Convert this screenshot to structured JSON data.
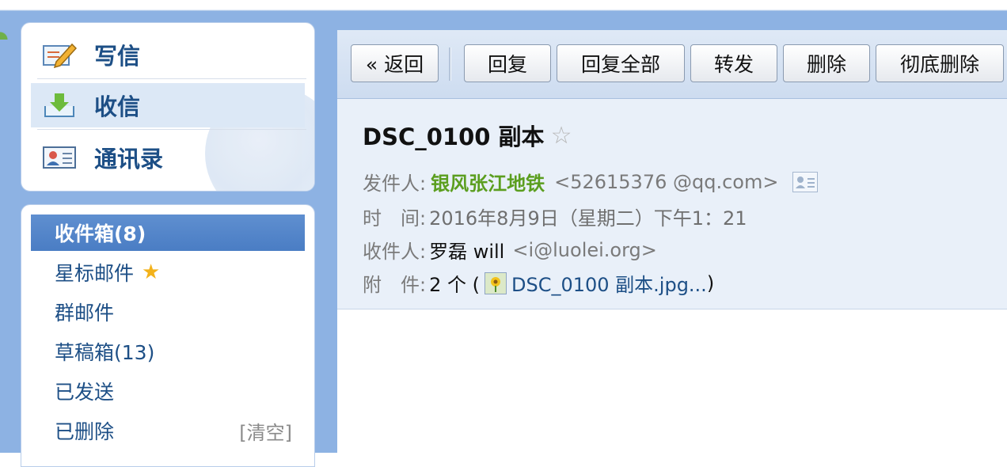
{
  "nav": {
    "compose": "写信",
    "inbox": "收信",
    "contacts": "通讯录"
  },
  "folders": {
    "inbox": "收件箱(8)",
    "starred": "星标邮件",
    "group": "群邮件",
    "drafts": "草稿箱(13)",
    "sent": "已发送",
    "deleted": "已删除",
    "clear": "[清空]"
  },
  "toolbar": {
    "back": "« 返回",
    "reply": "回复",
    "reply_all": "回复全部",
    "forward": "转发",
    "delete": "删除",
    "delete_permanently": "彻底删除"
  },
  "mail": {
    "subject": "DSC_0100 副本",
    "sender_label": "发件人:",
    "sender_name": "银风张江地铁",
    "sender_addr": "<52615376  @qq.com>",
    "time_label": "时　间:",
    "time_value": "2016年8月9日（星期二）下午1：21",
    "recipient_label": "收件人:",
    "recipient_name": "罗磊 will",
    "recipient_addr": "<i@luolei.org>",
    "attachment_label": "附　件:",
    "attachment_count": "2 个 (",
    "attachment_name": "DSC_0100 副本.jpg...",
    "attachment_close": ")"
  },
  "colors": {
    "frame_blue": "#8db2e3",
    "active_folder": "#4a7dc4",
    "link_blue": "#1d4f86",
    "sender_green": "#5b9e1f",
    "star_yellow": "#f3b21b"
  }
}
